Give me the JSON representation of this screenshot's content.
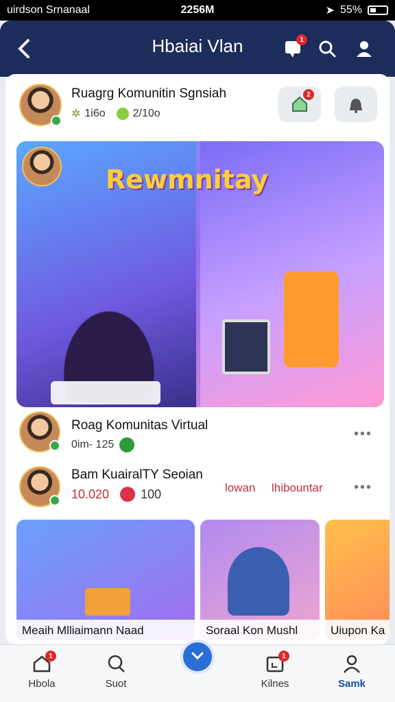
{
  "status_bar": {
    "carrier": "uirdson Srnanaal",
    "time": "2256M",
    "battery": "55%"
  },
  "header": {
    "title": "Hbaiai Vlan",
    "notif_badge": "1"
  },
  "post": {
    "author": "Ruagrg Komunitin Sgnsiah",
    "stat1": "1i6o",
    "stat2": "2/10o",
    "action_badge": "2"
  },
  "banner": {
    "title": "Rewmnitay"
  },
  "feed": [
    {
      "name": "Roag Komunitas Virtual",
      "meta": "0im- 125"
    },
    {
      "name": "Bam KuairalTY Seoian",
      "meta_value": "10.020",
      "meta_extra": "100",
      "tag1": "lowan",
      "tag2": "lhibountar"
    }
  ],
  "thumbs": [
    {
      "caption": "Meaih Mlliaimann Naad"
    },
    {
      "caption": "Soraal Kon Mushl"
    },
    {
      "caption": "Uiupon Ka"
    }
  ],
  "nav": {
    "items": [
      {
        "label": "Hbola",
        "badge": "1"
      },
      {
        "label": "Suot"
      },
      {
        "label": "Kilnes",
        "badge": "1"
      },
      {
        "label": "Samk"
      }
    ]
  }
}
